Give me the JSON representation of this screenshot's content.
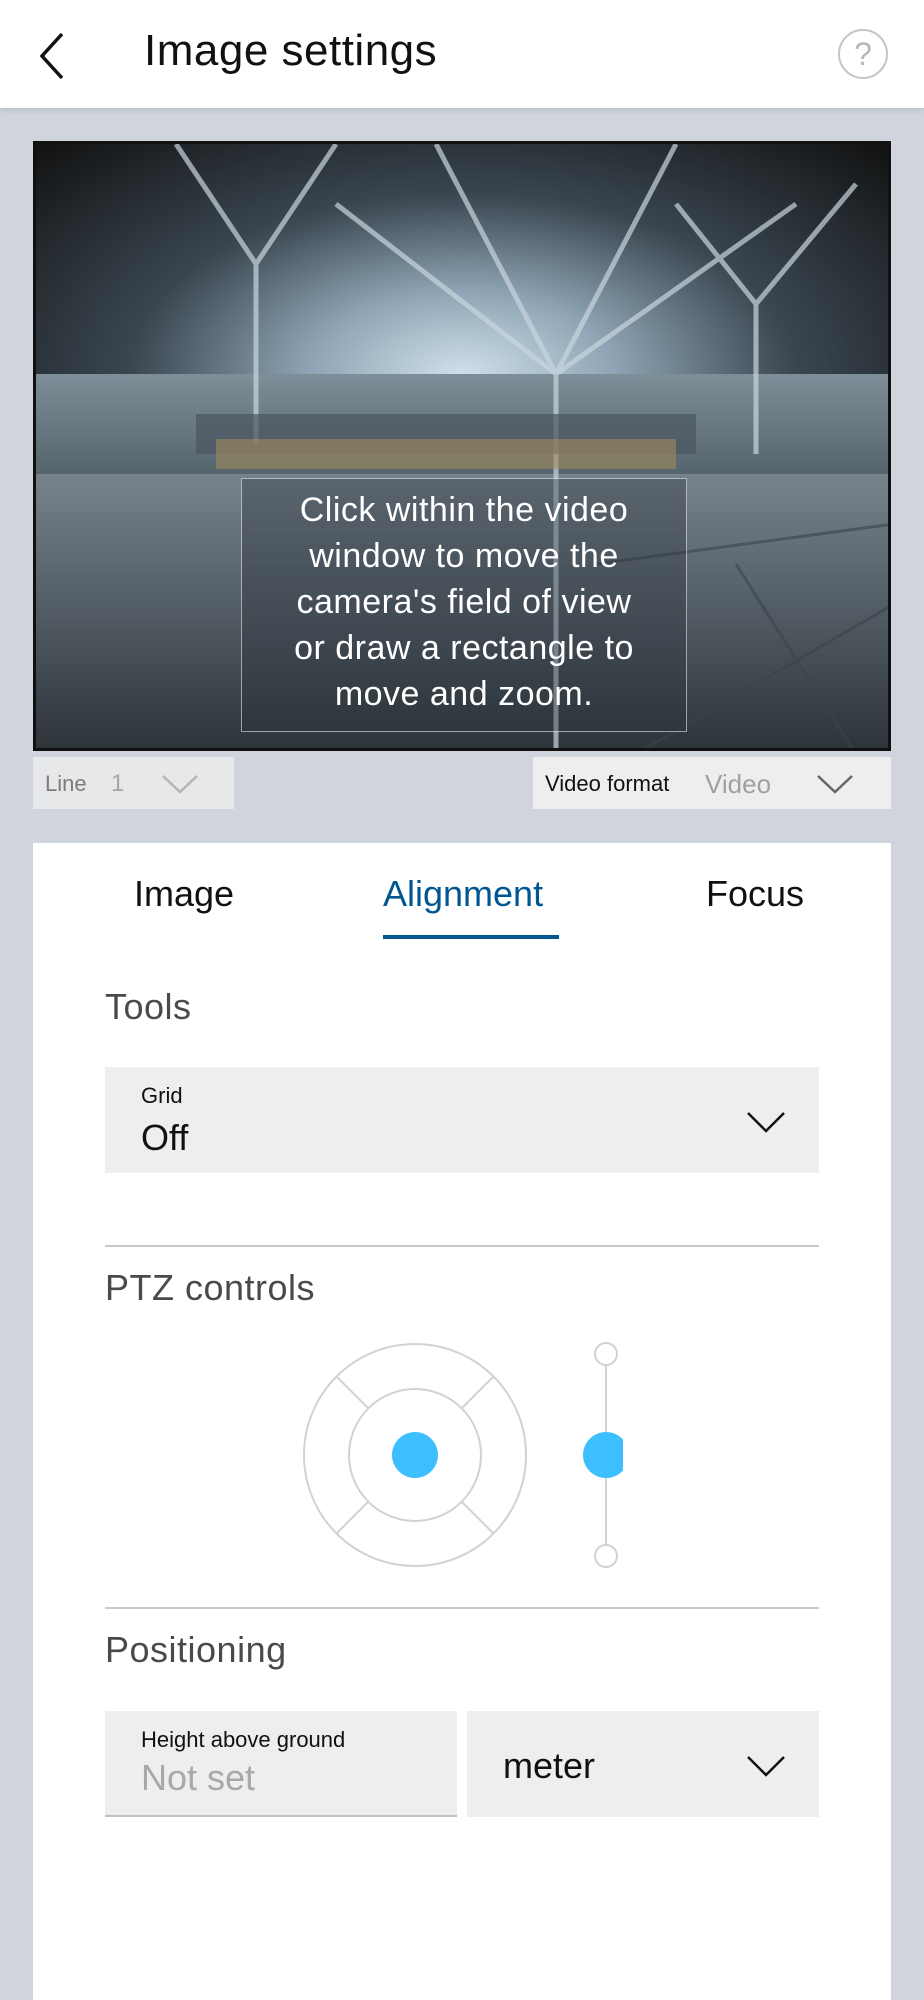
{
  "header": {
    "title": "Image settings",
    "help_glyph": "?"
  },
  "video": {
    "hint_lines": [
      "Click within the video",
      "window to move the",
      "camera's field of view",
      "or draw a rectangle to",
      "move and zoom."
    ]
  },
  "line_select": {
    "label": "Line",
    "value": "1"
  },
  "format_select": {
    "label": "Video format",
    "value": "Video"
  },
  "tabs": [
    {
      "label": "Image",
      "active": false
    },
    {
      "label": "Alignment",
      "active": true
    },
    {
      "label": "Focus",
      "active": false
    }
  ],
  "tools": {
    "title": "Tools",
    "grid": {
      "label": "Grid",
      "value": "Off"
    }
  },
  "ptz": {
    "title": "PTZ controls"
  },
  "positioning": {
    "title": "Positioning",
    "height": {
      "label": "Height above ground",
      "placeholder": "Not set"
    },
    "unit": {
      "value": "meter"
    }
  },
  "colors": {
    "accent": "#005691",
    "ptz_knob": "#3dbfff"
  },
  "icons": {
    "back": "chevron-left-icon",
    "help": "help-icon",
    "dropdown": "chevron-down-icon"
  }
}
